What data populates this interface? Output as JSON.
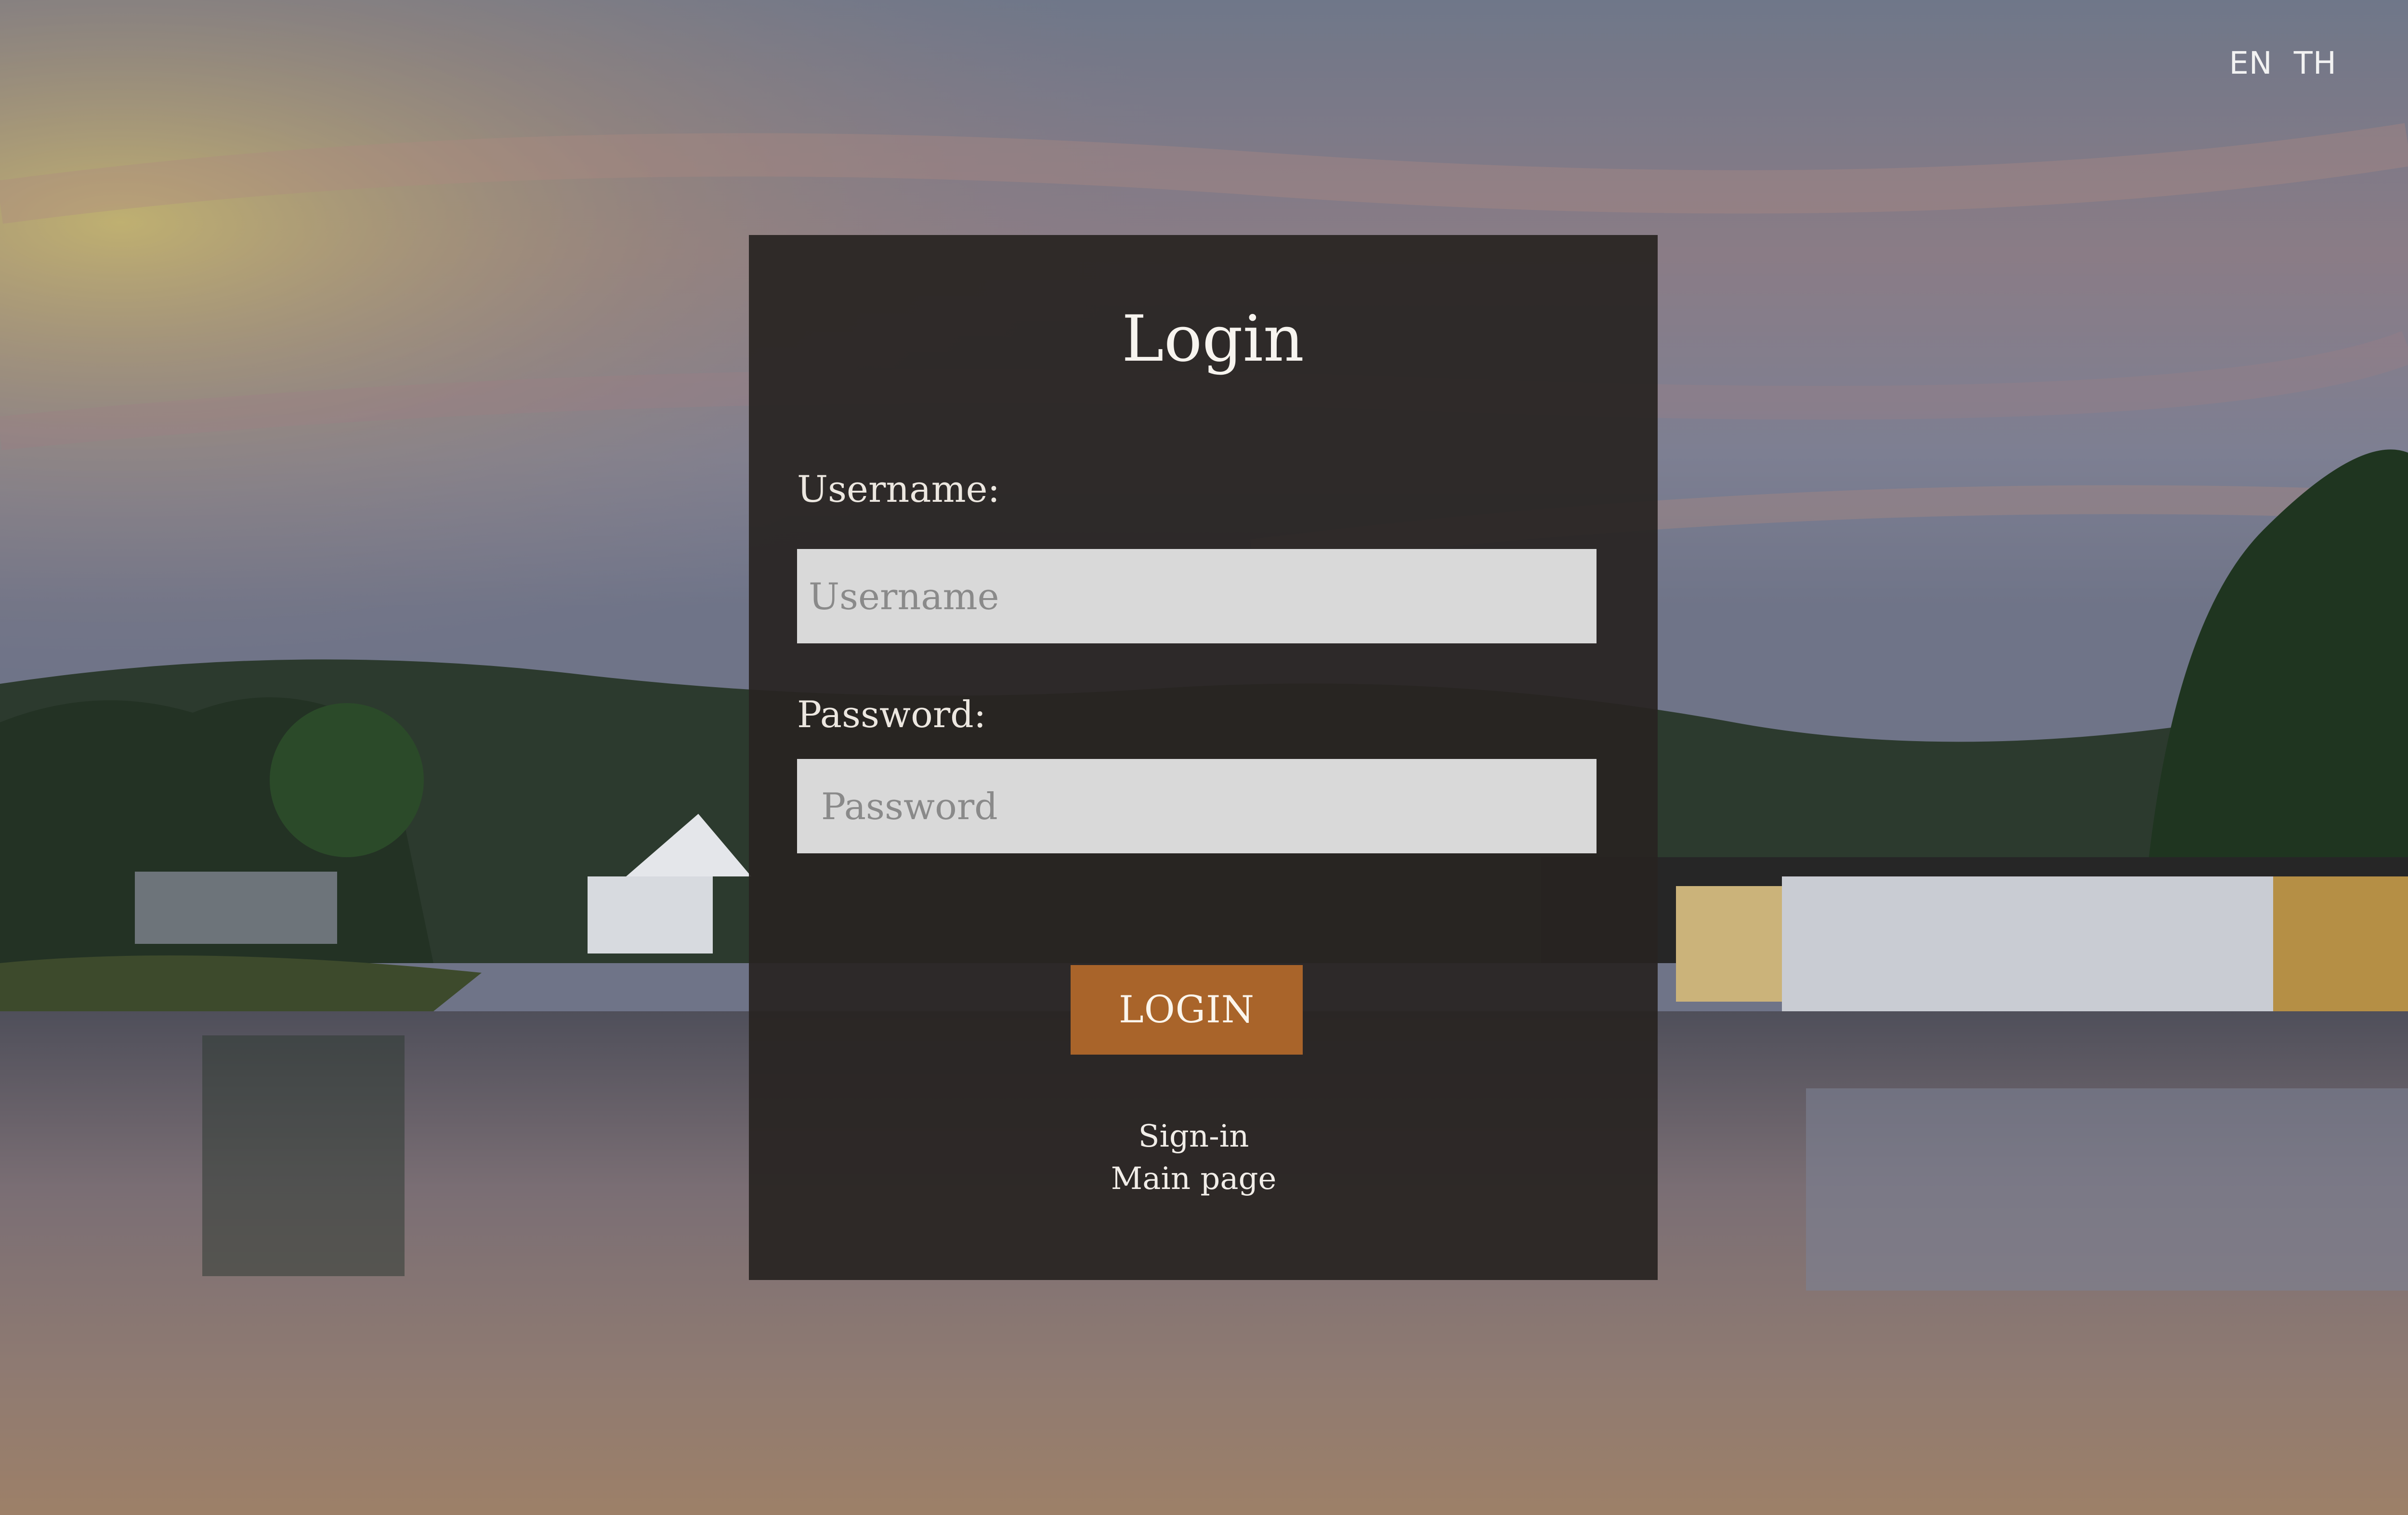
{
  "language_switch": {
    "en_label": "EN",
    "th_label": "TH"
  },
  "login_form": {
    "title": "Login",
    "username": {
      "label": "Username:",
      "placeholder": "Username",
      "value": ""
    },
    "password": {
      "label": "Password:",
      "placeholder": "Password",
      "value": ""
    },
    "submit_label": "LOGIN",
    "signin_link": "Sign-in",
    "main_page_link": "Main page"
  },
  "colors": {
    "card_background": "#282321",
    "input_background": "#d9d9d9",
    "button_accent": "#a9642a",
    "text_light": "#f7f4ef"
  },
  "background": {
    "description_icon": "lake-resort-sunset-photo"
  }
}
